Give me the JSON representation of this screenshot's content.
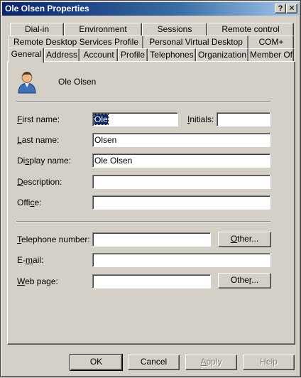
{
  "window": {
    "title": "Ole Olsen Properties",
    "help_glyph": "?",
    "close_glyph": "✕"
  },
  "tabs": {
    "row1": [
      "Dial-in",
      "Environment",
      "Sessions",
      "Remote control"
    ],
    "row2": [
      "Remote Desktop Services Profile",
      "Personal Virtual Desktop",
      "COM+"
    ],
    "row3": [
      "General",
      "Address",
      "Account",
      "Profile",
      "Telephones",
      "Organization",
      "Member Of"
    ],
    "active": "General"
  },
  "header": {
    "display_name": "Ole Olsen",
    "avatar_icon": "user-icon"
  },
  "form": {
    "first_name": {
      "label_u": "F",
      "label_rest": "irst name:",
      "value": "Ole"
    },
    "initials": {
      "label_u": "I",
      "label_rest": "nitials:",
      "value": ""
    },
    "last_name": {
      "label_u": "L",
      "label_rest": "ast name:",
      "value": "Olsen"
    },
    "display_name": {
      "label_pre": "Di",
      "label_u": "s",
      "label_rest": "play name:",
      "value": "Ole Olsen"
    },
    "description": {
      "label_u": "D",
      "label_rest": "escription:",
      "value": ""
    },
    "office": {
      "label_pre": "Offi",
      "label_u": "c",
      "label_rest": "e:",
      "value": ""
    },
    "telephone": {
      "label_u": "T",
      "label_rest": "elephone number:",
      "value": ""
    },
    "email": {
      "label_pre": "E-",
      "label_u": "m",
      "label_rest": "ail:",
      "value": ""
    },
    "web_page": {
      "label_u": "W",
      "label_rest": "eb page:",
      "value": ""
    },
    "other_phone": {
      "label_u": "O",
      "label_rest": "ther..."
    },
    "other_web": {
      "label_pre": "Othe",
      "label_u": "r",
      "label_rest": "..."
    }
  },
  "footer": {
    "ok": "OK",
    "cancel": "Cancel",
    "apply_u": "A",
    "apply_rest": "pply",
    "help": "Help"
  }
}
